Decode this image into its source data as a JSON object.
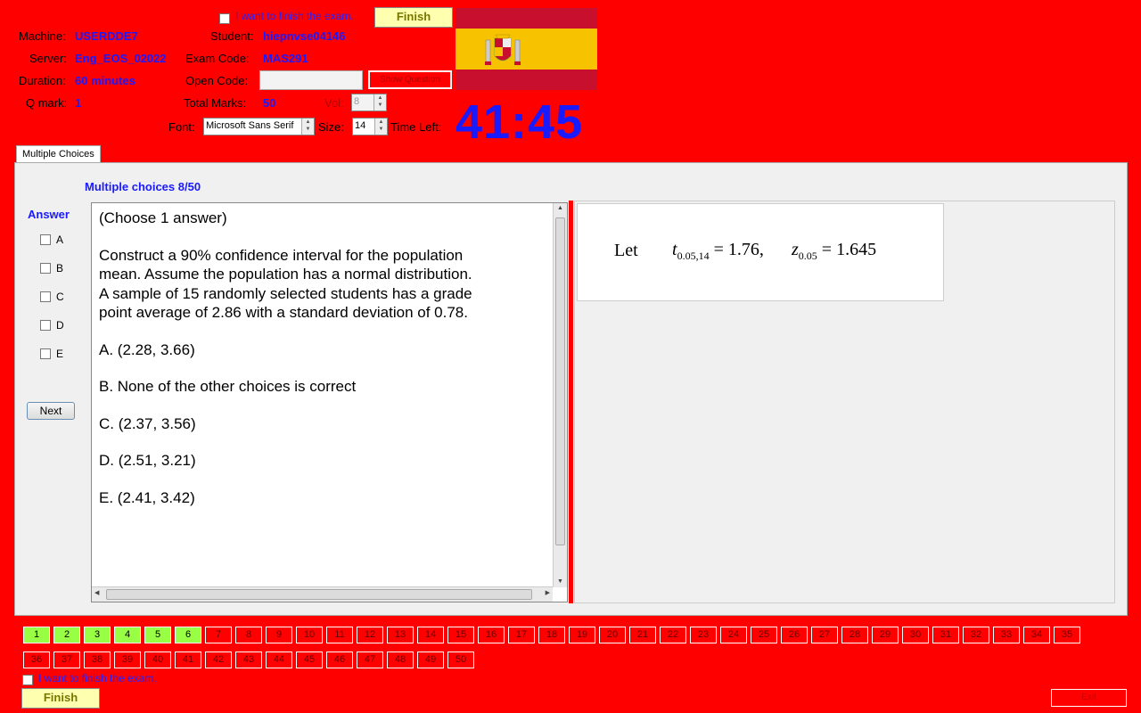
{
  "header": {
    "finish_check_label": "I want to finish the exam.",
    "finish_button": "Finish",
    "machine_label": "Machine:",
    "machine_value": "USERDDE7",
    "server_label": "Server:",
    "server_value": "Eng_EOS_02022",
    "duration_label": "Duration:",
    "duration_value": "60 minutes",
    "qmark_label": "Q mark:",
    "qmark_value": "1",
    "student_label": "Student:",
    "student_value": "hiepnvse04146",
    "examcode_label": "Exam Code:",
    "examcode_value": "MAS291",
    "opencode_label": "Open Code:",
    "opencode_value": "",
    "show_question_button": "Show Question",
    "total_marks_label": "Total Marks:",
    "total_marks_value": "50",
    "vol_label": "Vol:",
    "vol_value": "8",
    "font_label": "Font:",
    "font_value": "Microsoft Sans Serif",
    "size_label": "Size:",
    "size_value": "14",
    "time_left_label": "Time Left:",
    "time_left_value": "41:45"
  },
  "tab": {
    "label": "Multiple Choices"
  },
  "question": {
    "progress": "Multiple choices 8/50",
    "instruction": "(Choose 1 answer)",
    "body": "Construct a 90% confidence interval for the population mean.  Assume the population has a normal distribution. A sample of 15 randomly selected students has a grade point average of 2.86 with a standard deviation of 0.78.",
    "options": [
      "A.  (2.28, 3.66)",
      "B.  None of the other choices is correct",
      "C.  (2.37, 3.56)",
      "D.  (2.51, 3.21)",
      "E.  (2.41, 3.42)"
    ],
    "image_text": {
      "let": "Let",
      "t_sub": "0.05,14",
      "t_val": "= 1.76,",
      "z_sub": "0.05",
      "z_val": "= 1.645"
    }
  },
  "answer": {
    "title": "Answer",
    "choices": [
      "A",
      "B",
      "C",
      "D",
      "E"
    ],
    "next_button": "Next"
  },
  "navigator": {
    "numbers": [
      "1",
      "2",
      "3",
      "4",
      "5",
      "6",
      "7",
      "8",
      "9",
      "10",
      "11",
      "12",
      "13",
      "14",
      "15",
      "16",
      "17",
      "18",
      "19",
      "20",
      "21",
      "22",
      "23",
      "24",
      "25",
      "26",
      "27",
      "28",
      "29",
      "30",
      "31",
      "32",
      "33",
      "34",
      "35",
      "36",
      "37",
      "38",
      "39",
      "40",
      "41",
      "42",
      "43",
      "44",
      "45",
      "46",
      "47",
      "48",
      "49",
      "50"
    ],
    "answered": [
      "1",
      "2",
      "3",
      "4",
      "5",
      "6"
    ]
  },
  "footer": {
    "finish_check_label": "I want to finish the exam.",
    "finish_button": "Finish",
    "exit_button": "Exit"
  },
  "colors": {
    "background": "#ff0000",
    "accent_blue": "#1a1aff",
    "answered_green": "#99ff44"
  }
}
